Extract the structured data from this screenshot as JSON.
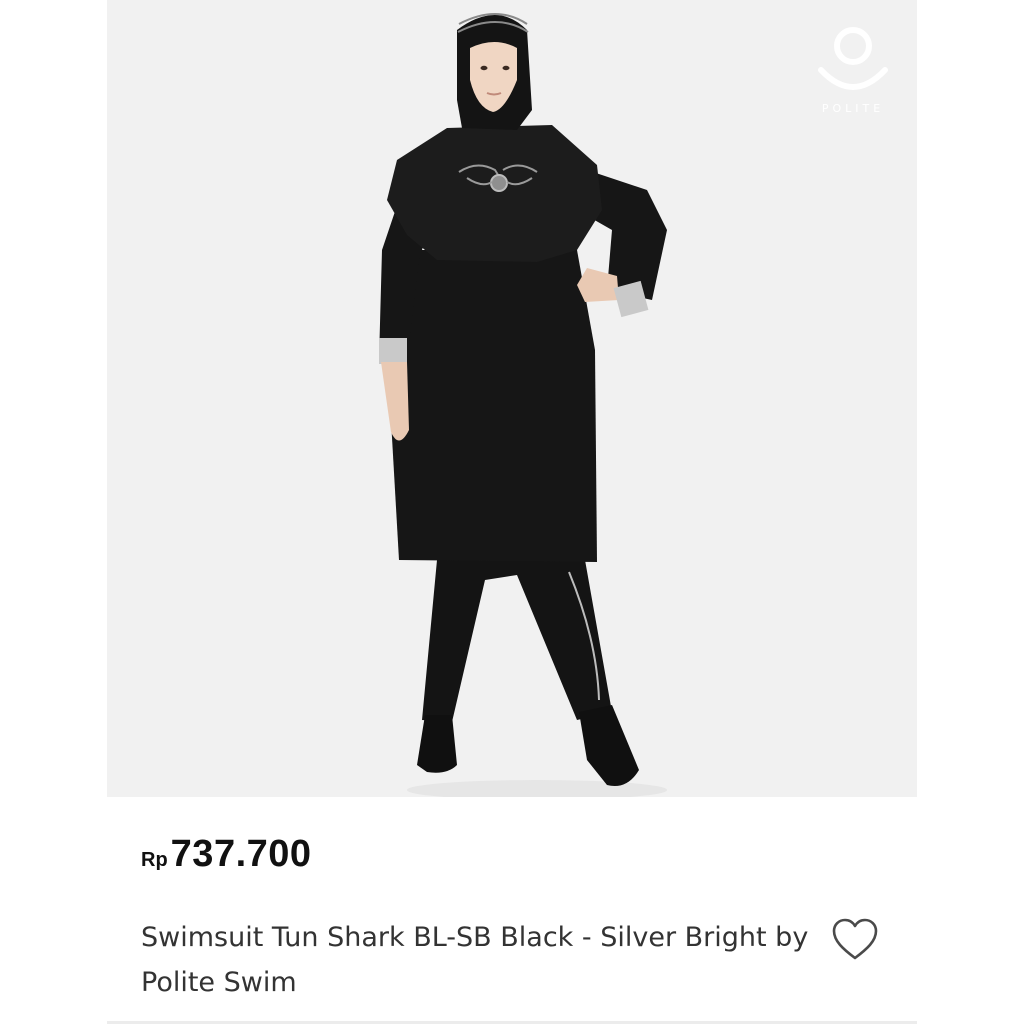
{
  "product": {
    "brand_logo_text": "POLITE",
    "price_currency": "Rp",
    "price_value": "737.700",
    "title": "Swimsuit Tun Shark BL-SB Black - Silver Bright by Polite Swim"
  },
  "icons": {
    "wishlist": "heart-outline-icon",
    "brand": "polite-logo-icon"
  },
  "colors": {
    "image_background": "#f1f1f1",
    "garment": "#141414",
    "cuff_accent": "#c9c9c9",
    "text_primary": "#111111",
    "text_secondary": "#333333"
  }
}
